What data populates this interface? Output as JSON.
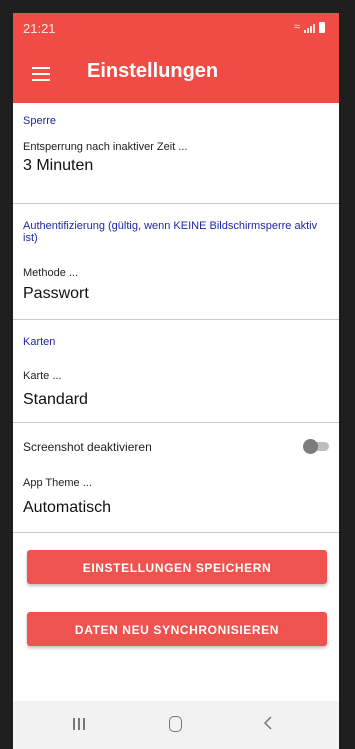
{
  "status_bar": {
    "time": "21:21",
    "icons": [
      "wifi-icon",
      "signal-icon",
      "battery-icon"
    ]
  },
  "app_bar": {
    "menu_icon": "hamburger-menu-icon",
    "title": "Einstellungen",
    "color": "#f14b46"
  },
  "sections": {
    "sperre": {
      "heading": "Sperre",
      "label": "Entsperrung nach inaktiver Zeit ...",
      "value": "3 Minuten"
    },
    "auth": {
      "heading": "Authentifizierung (gültig, wenn KEINE Bildschirmsperre aktiv ist)",
      "label": "Methode ...",
      "value": "Passwort"
    },
    "karten": {
      "heading": "Karten",
      "label": "Karte ...",
      "value": "Standard"
    },
    "screenshot": {
      "label": "Screenshot deaktivieren",
      "enabled": false
    },
    "theme": {
      "label": "App Theme ...",
      "value": "Automatisch"
    }
  },
  "buttons": {
    "save": "EINSTELLUNGEN SPEICHERN",
    "sync": "DATEN NEU SYNCHRONISIEREN",
    "color": "#ef5350"
  },
  "nav_bar": {
    "icons": [
      "recents-icon",
      "home-icon",
      "back-icon"
    ]
  },
  "colors": {
    "accent": "#f14b46",
    "section_heading": "#1e27a6"
  }
}
